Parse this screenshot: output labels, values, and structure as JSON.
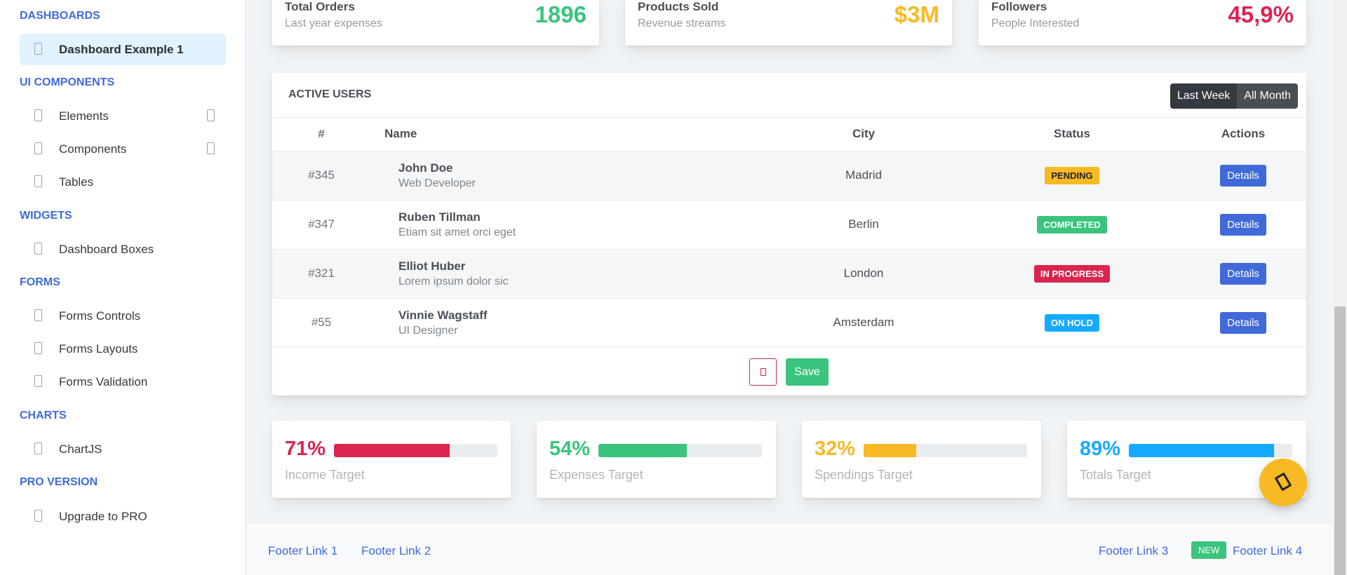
{
  "sidebar": {
    "sections": [
      {
        "heading": "DASHBOARDS",
        "items": [
          {
            "label": "Dashboard Example 1",
            "active": true
          }
        ]
      },
      {
        "heading": "UI COMPONENTS",
        "items": [
          {
            "label": "Elements",
            "expandable": true
          },
          {
            "label": "Components",
            "expandable": true
          },
          {
            "label": "Tables"
          }
        ]
      },
      {
        "heading": "WIDGETS",
        "items": [
          {
            "label": "Dashboard Boxes"
          }
        ]
      },
      {
        "heading": "FORMS",
        "items": [
          {
            "label": "Forms Controls"
          },
          {
            "label": "Forms Layouts"
          },
          {
            "label": "Forms Validation"
          }
        ]
      },
      {
        "heading": "CHARTS",
        "items": [
          {
            "label": "ChartJS"
          }
        ]
      },
      {
        "heading": "PRO VERSION",
        "items": [
          {
            "label": "Upgrade to PRO"
          }
        ]
      }
    ]
  },
  "widgets": [
    {
      "heading": "Total Orders",
      "sub": "Last year expenses",
      "value": "1896",
      "color": "#3ac47d"
    },
    {
      "heading": "Products Sold",
      "sub": "Revenue streams",
      "value": "$3M",
      "color": "#f7b924"
    },
    {
      "heading": "Followers",
      "sub": "People Interested",
      "value": "45,9%",
      "color": "#d92550"
    }
  ],
  "users": {
    "title": "Active Users",
    "filters": [
      "Last Week",
      "All Month"
    ],
    "columns": [
      "#",
      "Name",
      "City",
      "Status",
      "Actions"
    ],
    "rows": [
      {
        "id": "#345",
        "name": "John Doe",
        "role": "Web Developer",
        "city": "Madrid",
        "status": "Pending",
        "status_bg": "#f7b924",
        "status_fg": "#212529",
        "action": "Details"
      },
      {
        "id": "#347",
        "name": "Ruben Tillman",
        "role": "Etiam sit amet orci eget",
        "city": "Berlin",
        "status": "Completed",
        "status_bg": "#3ac47d",
        "status_fg": "#ffffff",
        "action": "Details"
      },
      {
        "id": "#321",
        "name": "Elliot Huber",
        "role": "Lorem ipsum dolor sic",
        "city": "London",
        "status": "In Progress",
        "status_bg": "#d92550",
        "status_fg": "#ffffff",
        "action": "Details"
      },
      {
        "id": "#55",
        "name": "Vinnie Wagstaff",
        "role": "UI Designer",
        "city": "Amsterdam",
        "status": "On Hold",
        "status_bg": "#16aaff",
        "status_fg": "#ffffff",
        "action": "Details"
      }
    ],
    "trash_icon": "trash-icon",
    "save_label": "Save"
  },
  "progress": [
    {
      "pct_label": "71%",
      "value": 0.71,
      "caption": "Income Target",
      "color": "#d92550"
    },
    {
      "pct_label": "54%",
      "value": 0.54,
      "caption": "Expenses Target",
      "color": "#3ac47d"
    },
    {
      "pct_label": "32%",
      "value": 0.32,
      "caption": "Spendings Target",
      "color": "#f7b924"
    },
    {
      "pct_label": "89%",
      "value": 0.89,
      "caption": "Totals Target",
      "color": "#16aaff"
    }
  ],
  "fab_icon": "settings-icon",
  "footer": {
    "left_links": [
      "Footer Link 1",
      "Footer Link 2"
    ],
    "right_link_1": "Footer Link 3",
    "badge": "NEW",
    "right_link_2": "Footer Link 4"
  }
}
